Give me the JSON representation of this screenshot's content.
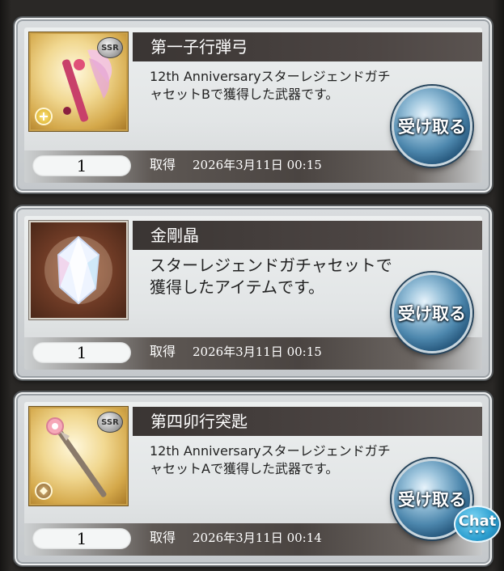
{
  "items": [
    {
      "name": "第一子行弾弓",
      "description": "12th AnniversaryスターレジェンドガチャセットBで獲得した武器です。",
      "quantity": "1",
      "obtained_label": "取得",
      "timestamp": "2026年3月11日 00:15",
      "button_label": "受け取る",
      "rarity": "SSR",
      "thumb_type": "weapon",
      "icon": "crossbow-weapon-icon"
    },
    {
      "name": "金剛晶",
      "description": "スターレジェンドガチャセットで獲得したアイテムです。",
      "quantity": "1",
      "obtained_label": "取得",
      "timestamp": "2026年3月11日 00:15",
      "button_label": "受け取る",
      "rarity": "",
      "thumb_type": "item",
      "icon": "crystal-icon"
    },
    {
      "name": "第四卯行突匙",
      "description": "12th AnniversaryスターレジェンドガチャセットAで獲得した武器です。",
      "quantity": "1",
      "obtained_label": "取得",
      "timestamp": "2026年3月11日 00:14",
      "button_label": "受け取る",
      "rarity": "SSR",
      "thumb_type": "weapon",
      "icon": "staff-weapon-icon"
    }
  ],
  "chat": {
    "label": "Chat"
  },
  "colors": {
    "title_bar": "#3a3533",
    "button_blue": "#4d87ad",
    "frame_gold": "#c9a04a",
    "chat_blue": "#2c9fd0"
  }
}
